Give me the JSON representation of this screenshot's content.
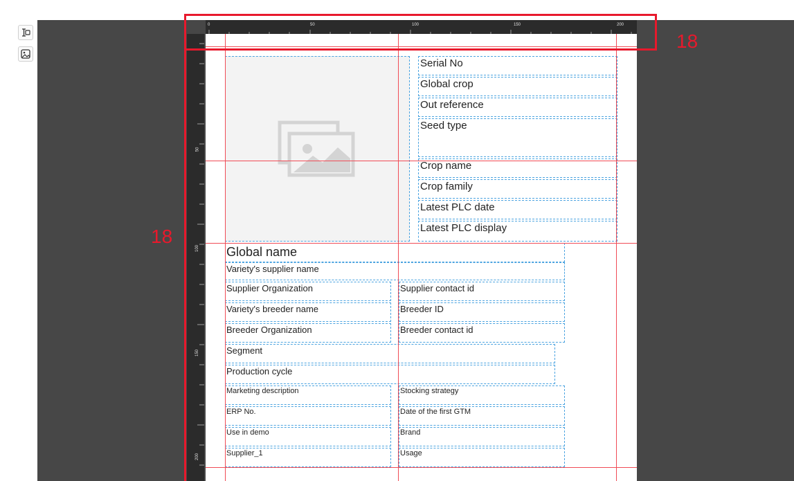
{
  "toolbar": {
    "items": [
      {
        "name": "text-field-icon",
        "label": "text field tool"
      },
      {
        "name": "image-icon",
        "label": "image tool"
      }
    ]
  },
  "rulers": {
    "horizontal_labels": [
      "0",
      "50",
      "100",
      "150",
      "200"
    ],
    "vertical_labels": [
      "50",
      "100",
      "150",
      "200"
    ]
  },
  "image_placeholder": {
    "icon": "image-placeholder-icon"
  },
  "fields": {
    "serial_no": "Serial No",
    "global_crop": "Global crop",
    "out_reference": "Out reference",
    "seed_type": "Seed type",
    "crop_name": "Crop name",
    "crop_family": "Crop family",
    "latest_plc_date": "Latest PLC date",
    "latest_plc_display": "Latest PLC display",
    "global_name": "Global name",
    "variety_supplier_name": "Variety's supplier name",
    "supplier_organization": "Supplier Organization",
    "supplier_contact_id": "Supplier contact id",
    "variety_breeder_name": "Variety's breeder name",
    "breeder_id": "Breeder ID",
    "breeder_organization": "Breeder Organization",
    "breeder_contact_id": "Breeder contact id",
    "segment": "Segment",
    "production_cycle": "Production cycle",
    "marketing_description": "Marketing description",
    "stocking_strategy": "Stocking strategy",
    "erp_no": "ERP No.",
    "date_first_gtm": "Date of the first GTM",
    "use_in_demo": "Use in demo",
    "brand": "Brand",
    "supplier_1": "Supplier_1",
    "usage": "Usage"
  },
  "annotations": {
    "top_margin": "18",
    "left_margin": "18"
  },
  "colors": {
    "accent_red": "#e8192c",
    "guide_red": "#f04b55",
    "field_border": "#4aa3e0",
    "canvas": "#474747",
    "ruler": "#2b2b2b"
  }
}
